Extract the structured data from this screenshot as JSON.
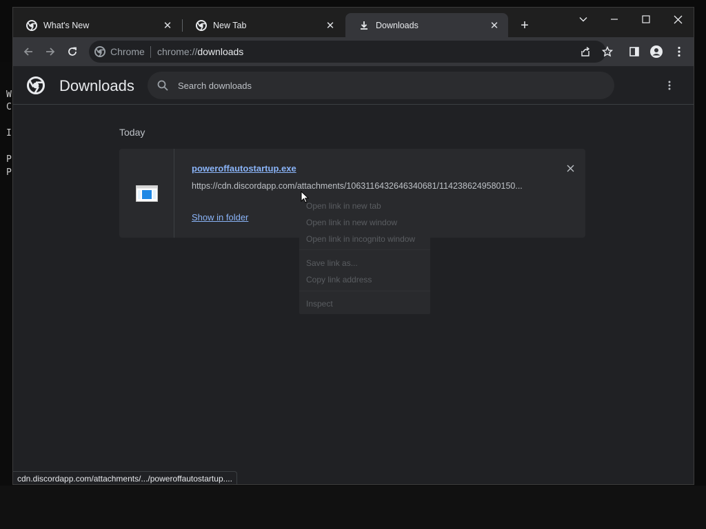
{
  "tabs": [
    {
      "title": "What's New",
      "icon": "chrome-icon",
      "active": false
    },
    {
      "title": "New Tab",
      "icon": "chrome-icon",
      "active": false
    },
    {
      "title": "Downloads",
      "icon": "download-icon",
      "active": true
    }
  ],
  "omnibox": {
    "site_chip": "Chrome",
    "url_scheme": "chrome://",
    "url_host": "downloads"
  },
  "page": {
    "title": "Downloads",
    "search_placeholder": "Search downloads",
    "date_label": "Today"
  },
  "download": {
    "file_name": "poweroffautostartup.exe",
    "url": "https://cdn.discordapp.com/attachments/1063116432646340681/1142386249580150...",
    "action_label": "Show in folder"
  },
  "context_menu": {
    "items": [
      "Open link in new tab",
      "Open link in new window",
      "Open link in incognito window",
      "Save link as...",
      "Copy link address",
      "Inspect"
    ]
  },
  "status_bar": {
    "text": "cdn.discordapp.com/attachments/.../poweroffautostartup...."
  },
  "background_terminal": {
    "lines": [
      "W",
      "C",
      "I",
      "P",
      "P"
    ]
  },
  "colors": {
    "link": "#8ab4f8",
    "page_bg": "#202124",
    "toolbar_bg": "#35363a",
    "tabstrip_bg": "#1f1f1f"
  }
}
